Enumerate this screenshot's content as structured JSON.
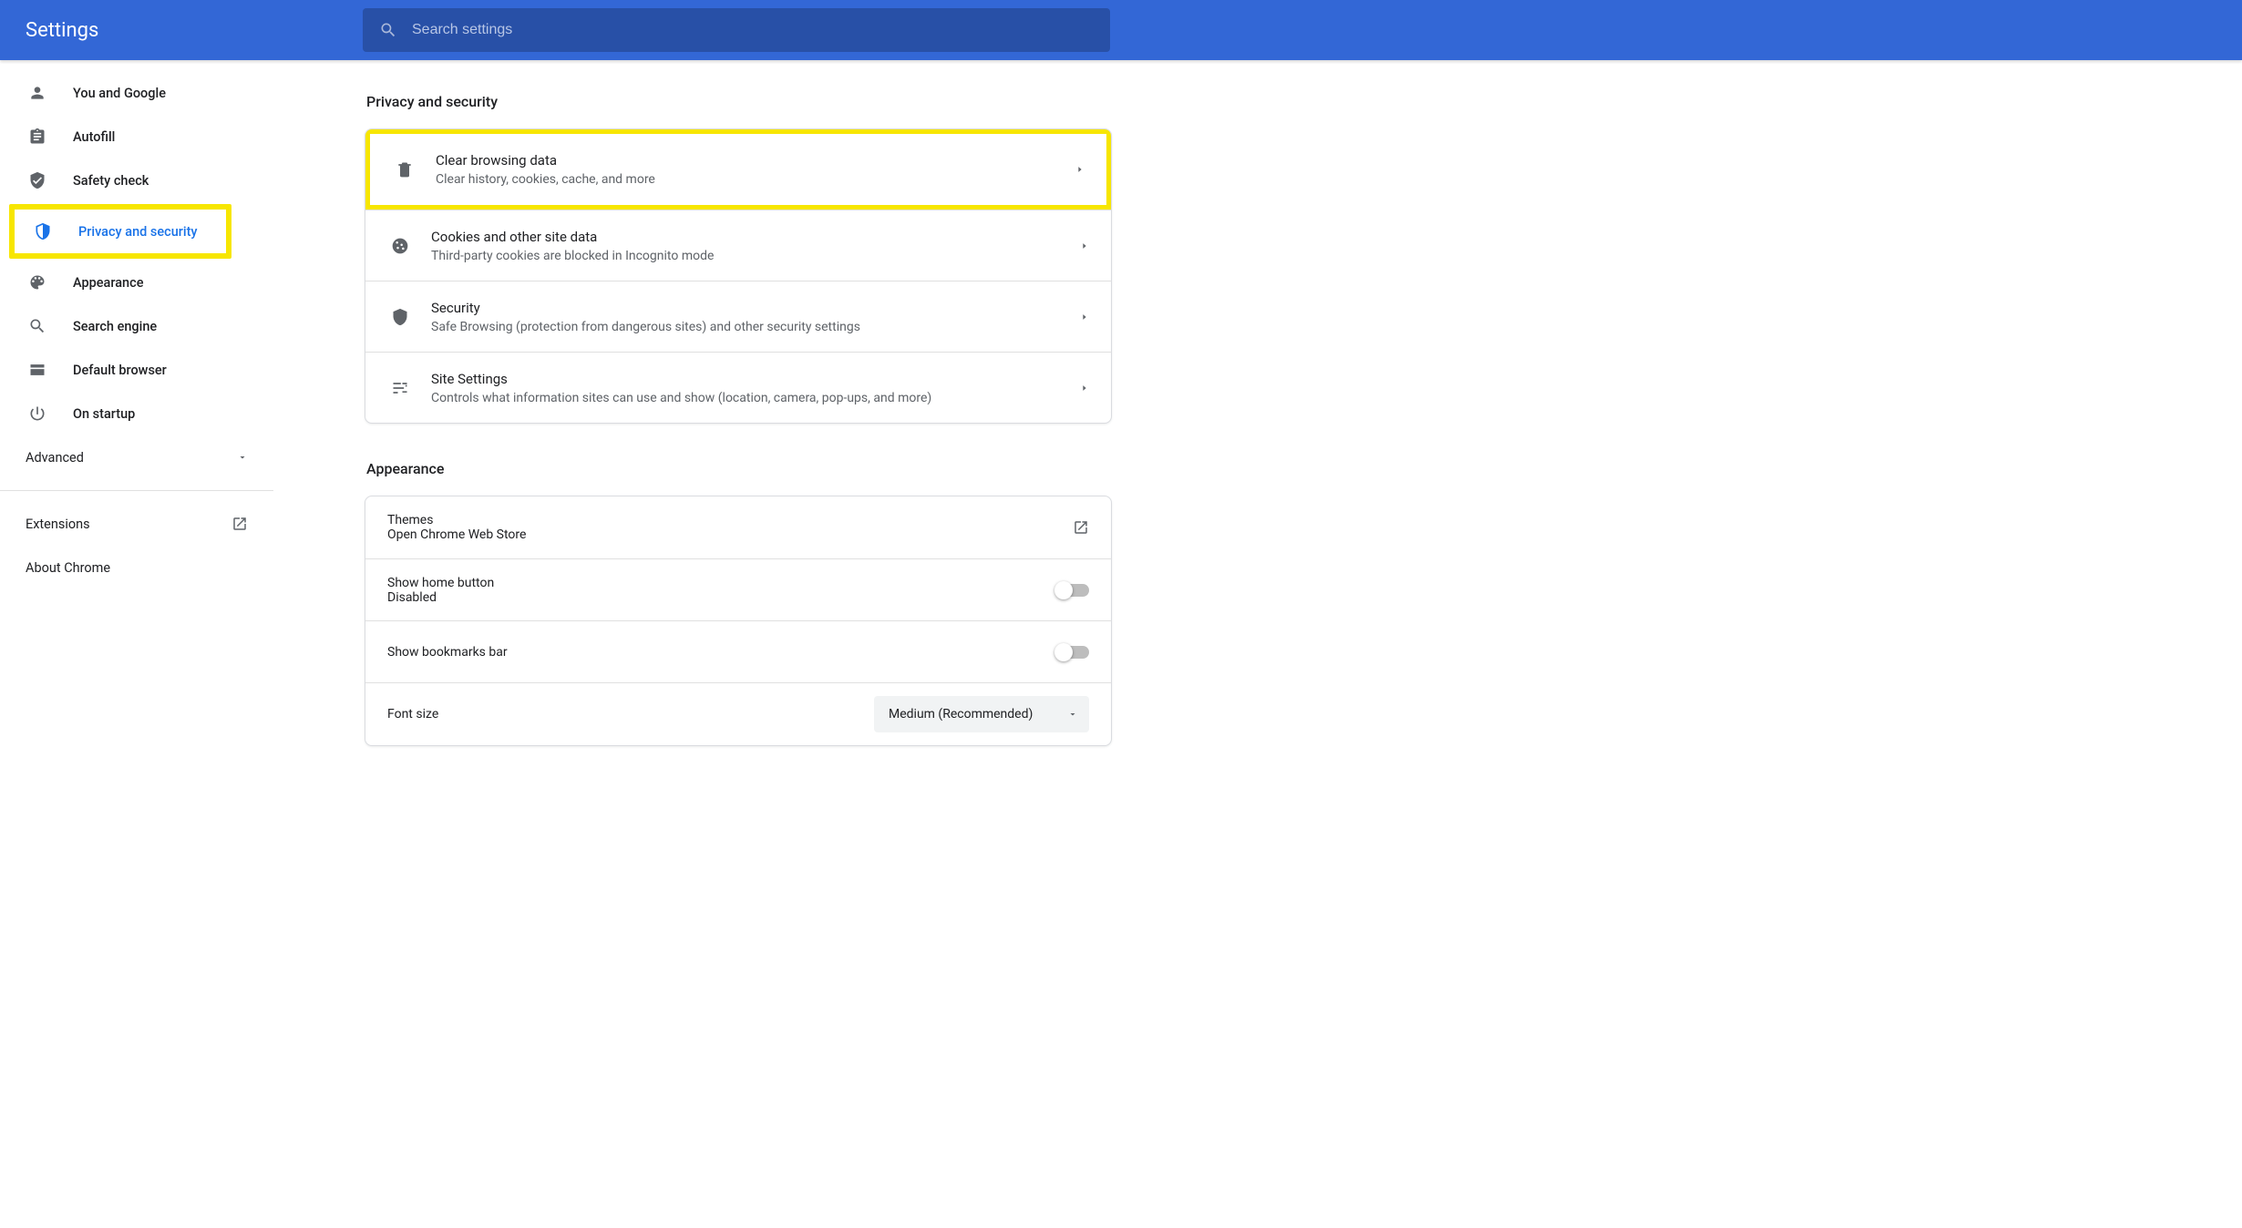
{
  "header": {
    "title": "Settings",
    "search_placeholder": "Search settings"
  },
  "sidebar": {
    "items": [
      {
        "id": "you-and-google",
        "label": "You and Google"
      },
      {
        "id": "autofill",
        "label": "Autofill"
      },
      {
        "id": "safety-check",
        "label": "Safety check"
      },
      {
        "id": "privacy",
        "label": "Privacy and security"
      },
      {
        "id": "appearance",
        "label": "Appearance"
      },
      {
        "id": "search-engine",
        "label": "Search engine"
      },
      {
        "id": "default-browser",
        "label": "Default browser"
      },
      {
        "id": "on-startup",
        "label": "On startup"
      }
    ],
    "advanced_label": "Advanced",
    "extensions_label": "Extensions",
    "about_label": "About Chrome"
  },
  "sections": {
    "privacy": {
      "title": "Privacy and security",
      "rows": [
        {
          "title": "Clear browsing data",
          "sub": "Clear history, cookies, cache, and more"
        },
        {
          "title": "Cookies and other site data",
          "sub": "Third-party cookies are blocked in Incognito mode"
        },
        {
          "title": "Security",
          "sub": "Safe Browsing (protection from dangerous sites) and other security settings"
        },
        {
          "title": "Site Settings",
          "sub": "Controls what information sites can use and show (location, camera, pop-ups, and more)"
        }
      ]
    },
    "appearance": {
      "title": "Appearance",
      "themes": {
        "title": "Themes",
        "sub": "Open Chrome Web Store"
      },
      "home_button": {
        "title": "Show home button",
        "sub": "Disabled",
        "enabled": false
      },
      "bookmarks_bar": {
        "title": "Show bookmarks bar",
        "enabled": false
      },
      "font_size": {
        "title": "Font size",
        "value": "Medium (Recommended)"
      }
    }
  },
  "highlights": {
    "sidebar_item": "privacy",
    "content_row": 0
  }
}
